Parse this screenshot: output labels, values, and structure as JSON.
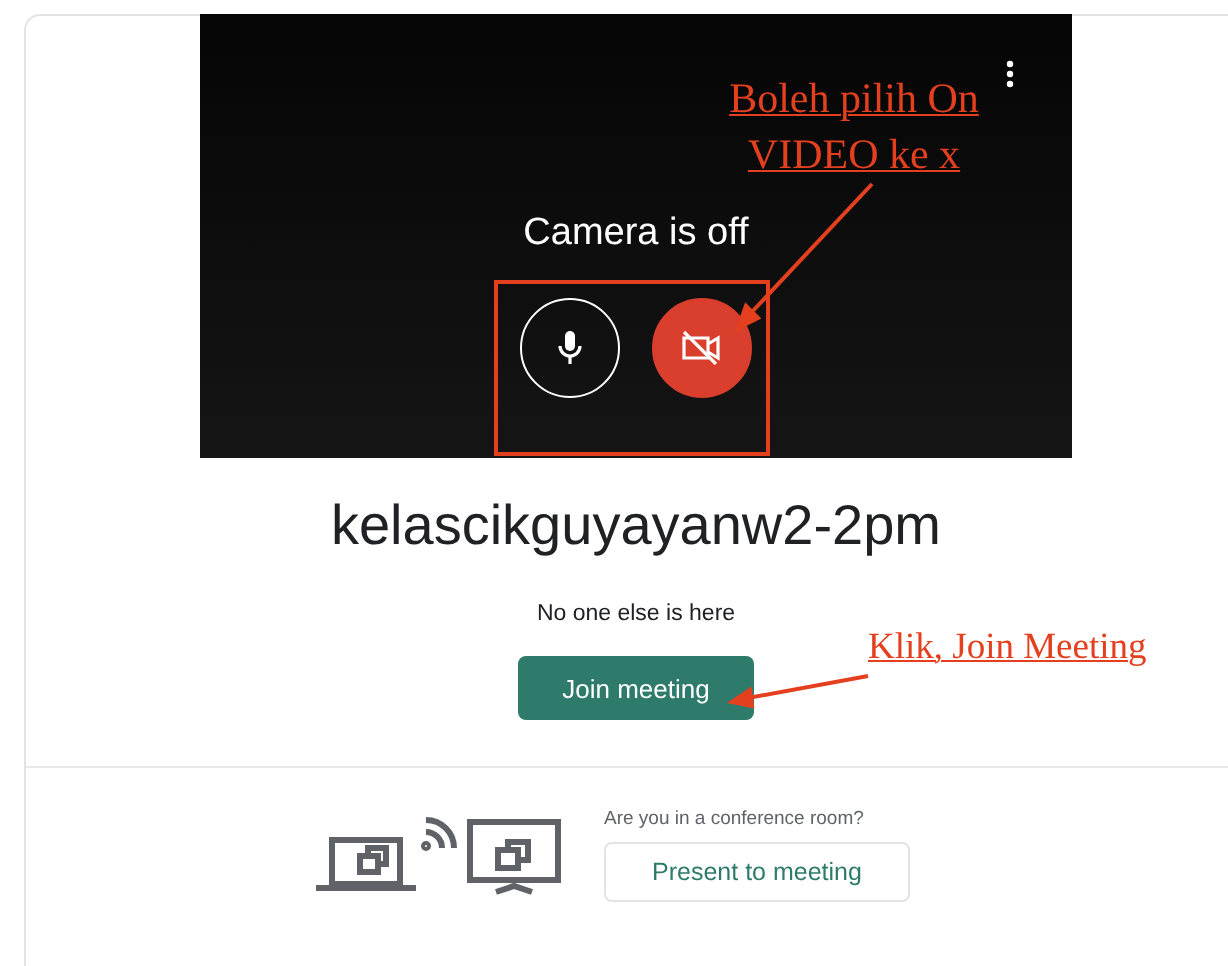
{
  "preview": {
    "status": "Camera is off",
    "controls": [
      {
        "kind": "mic",
        "on": true
      },
      {
        "kind": "camera",
        "on": false
      }
    ]
  },
  "meeting": {
    "title": "kelascikguyayanw2-2pm",
    "status": "No one else is here",
    "join_button": "Join meeting"
  },
  "conference": {
    "question": "Are you in a conference room?",
    "present_button": "Present to meeting"
  },
  "annotations": [
    {
      "text": "Boleh pilih On VIDEO ke x"
    },
    {
      "text": "Klik, Join Meeting"
    }
  ]
}
